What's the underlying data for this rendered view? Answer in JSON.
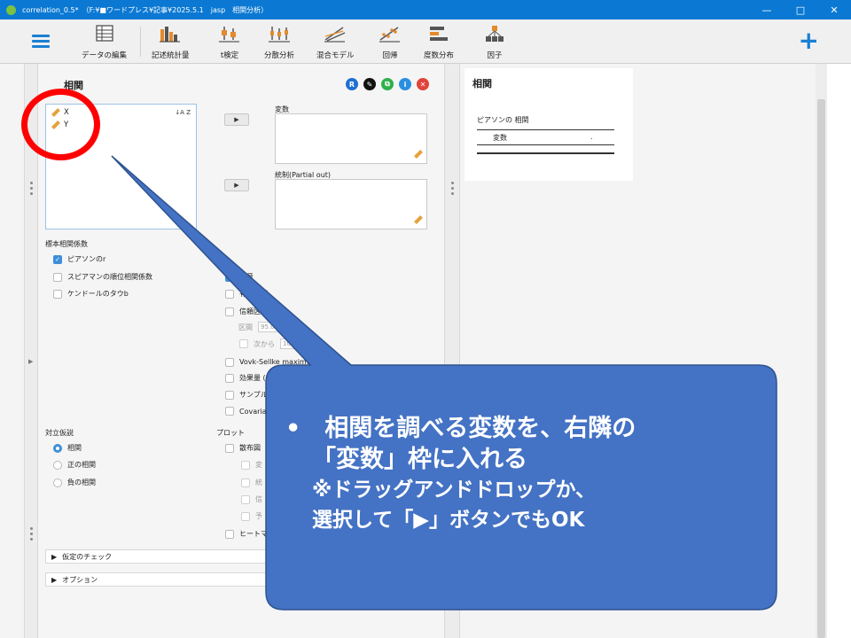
{
  "window": {
    "title": "correlation_0.5*　（F:¥■ワードプレス¥記事¥2025.5.1　jasp　相関分析）",
    "controls": {
      "minimize": "—",
      "maximize": "□",
      "close": "✕"
    }
  },
  "toolbar": {
    "tools": [
      {
        "label": "データの編集",
        "icon": "spreadsheet-icon"
      },
      {
        "label": "記述統計量",
        "icon": "bar-chart-icon"
      },
      {
        "label": "t検定",
        "icon": "t-test-icon"
      },
      {
        "label": "分散分析",
        "icon": "anova-icon"
      },
      {
        "label": "混合モデル",
        "icon": "mixed-model-icon"
      },
      {
        "label": "回帰",
        "icon": "regression-icon"
      },
      {
        "label": "度数分布",
        "icon": "frequencies-icon"
      },
      {
        "label": "因子",
        "icon": "factor-icon"
      }
    ],
    "plus": "+"
  },
  "analysis": {
    "title": "相関",
    "header_icons": [
      {
        "glyph": "R",
        "color": "#1f6fd1"
      },
      {
        "glyph": "✎",
        "color": "#111111"
      },
      {
        "glyph": "⧉",
        "color": "#2fb14a"
      },
      {
        "glyph": "i",
        "color": "#2b8fe0"
      },
      {
        "glyph": "✕",
        "color": "#e0443a"
      }
    ],
    "variables": [
      "X",
      "Y"
    ],
    "sort_glyph": "↓A Z",
    "arrow": "▶",
    "variables_box_label": "変数",
    "partial_box_label": "統制(Partial out)",
    "coef_section": "標本相関係数",
    "coefs": [
      {
        "label": "ピアソンのr",
        "checked": true
      },
      {
        "label": "スピアマンの順位相関係数",
        "checked": false
      },
      {
        "label": "ケンドールのタウb",
        "checked": false
      }
    ],
    "additional": [
      {
        "label": "有意",
        "checked": true
      },
      {
        "label": "有意な相",
        "checked": false
      },
      {
        "label": "信頼区間",
        "checked": false
      }
    ],
    "ci": {
      "interval_label": "区間",
      "interval_value": "95.0",
      "percent": "%",
      "boot_label": "次から",
      "boot_value": "1000",
      "boot_suffix": "ブ"
    },
    "more": [
      {
        "label": "Vovk-Sellke maximum p比",
        "checked": false
      },
      {
        "label": "効果量 (Fish",
        "checked": false
      },
      {
        "label": "サンプルサ",
        "checked": false
      },
      {
        "label": "Covariar",
        "checked": false
      }
    ],
    "hyp_section": "対立仮説",
    "hypotheses": [
      {
        "label": "相関",
        "selected": true
      },
      {
        "label": "正の相関",
        "selected": false
      },
      {
        "label": "負の相関",
        "selected": false
      }
    ],
    "plot_section": "プロット",
    "plots": {
      "scatter": "散布図",
      "sub": [
        "変",
        "統",
        "信",
        "予"
      ],
      "heatmap": "ヒートマッ"
    },
    "collapsibles": [
      "仮定のチェック",
      "オプション"
    ]
  },
  "results": {
    "title": "相関",
    "table_title": "ピアソンの 相関",
    "col_header": "変数",
    "empty_cell": "."
  },
  "callout": {
    "bullet": "•",
    "line1": "相関を調べる変数を、右隣の",
    "line2": "「変数」枠に入れる",
    "line3": "※ドラッグアンドドロップか、",
    "line4": "選択して「▶」ボタンでもOK",
    "fill": "#4472c4",
    "stroke": "#2f528f"
  },
  "colors": {
    "accent": "#0b79d3",
    "check": "#3d8fd9",
    "highlight": "#ff0000"
  }
}
